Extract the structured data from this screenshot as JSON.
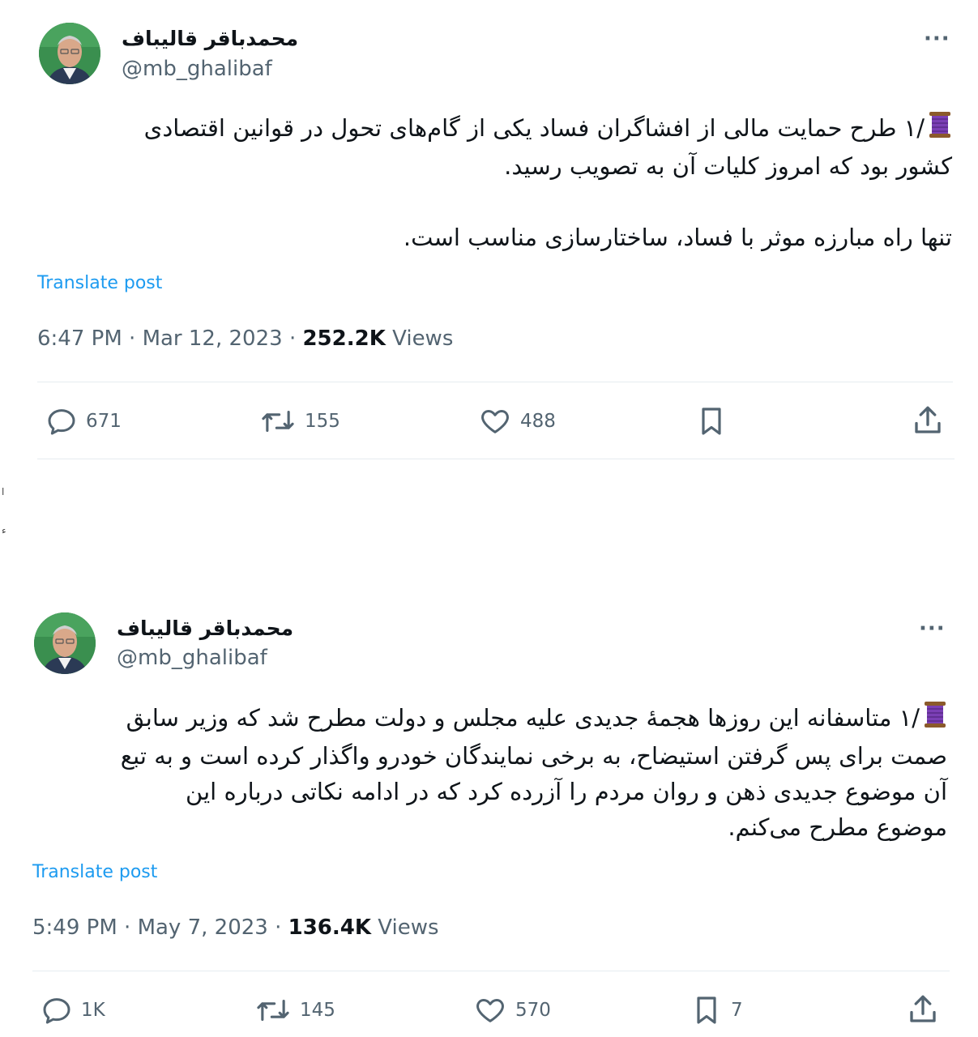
{
  "tweets": [
    {
      "author_name": "محمدباقر قالیباف",
      "handle": "@mb_ghalibaf",
      "more": "···",
      "lines": [
        "/۱ طرح حمایت مالی از افشاگران فساد یکی از گام‌های تحول در قوانین اقتصادی",
        "کشور بود که امروز کلیات آن به تصویب رسید.",
        "",
        "تنها راه مبارزه موثر با فساد، ساختارسازی مناسب است."
      ],
      "translate": "Translate post",
      "time": "6:47 PM",
      "date": "Mar 12, 2023",
      "views_count": "252.2K",
      "views_label": "Views",
      "replies": "671",
      "reposts": "155",
      "likes": "488",
      "bookmarks": ""
    },
    {
      "author_name": "محمدباقر قالیباف",
      "handle": "@mb_ghalibaf",
      "more": "···",
      "lines": [
        "/۱ متاسفانه این روزها هجمهٔ جدیدی علیه مجلس و دولت مطرح شد که وزیر سابق",
        "صمت برای پس گرفتن استیضاح، به برخی نمایندگان خودرو واگذار کرده است و به تبع",
        "آن موضوع جدیدی ذهن و روان مردم را آزرده کرد که در ادامه  نکاتی درباره این",
        "موضوع مطرح می‌کنم."
      ],
      "translate": "Translate post",
      "time": "5:49 PM",
      "date": "May 7, 2023",
      "views_count": "136.4K",
      "views_label": "Views",
      "replies": "1K",
      "reposts": "145",
      "likes": "570",
      "bookmarks": "7"
    }
  ],
  "separator": "·",
  "icons": {
    "reply": "reply-icon",
    "repost": "repost-icon",
    "like": "heart-icon",
    "bookmark": "bookmark-icon",
    "share": "share-icon",
    "spool": "thread-spool-icon"
  },
  "colors": {
    "link": "#1d9bf0",
    "secondary": "#536471",
    "text": "#0f1419"
  }
}
